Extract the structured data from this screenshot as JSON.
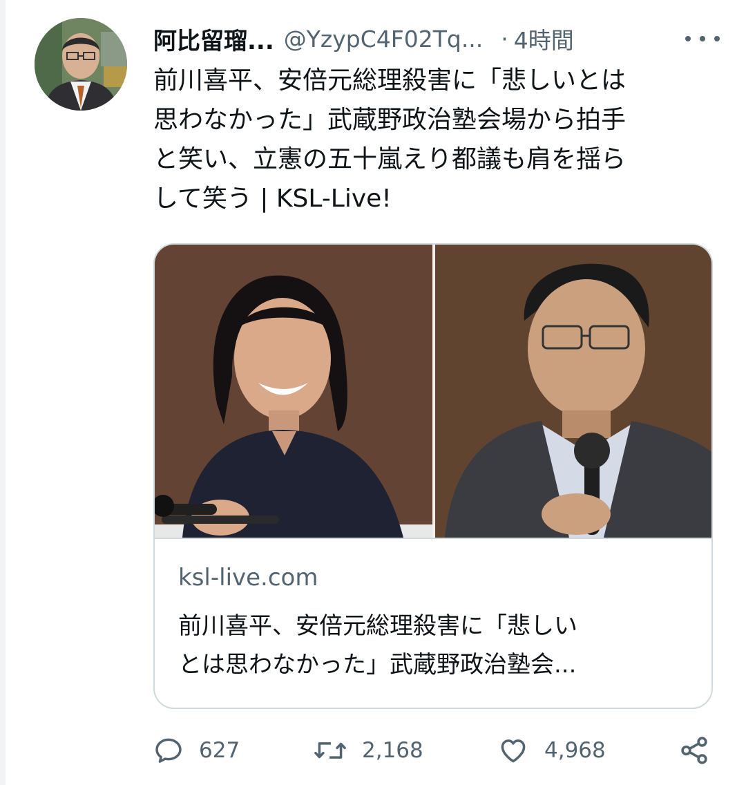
{
  "tweet": {
    "author": {
      "display_name": "阿比留瑠...",
      "handle": "@YzypC4F02Tq...",
      "separator": "·",
      "time": "4時間"
    },
    "text_lines": [
      "前川喜平、安倍元総理殺害に「悲しいとは",
      "思わなかった」武蔵野政治塾会場から拍手",
      "と笑い、立憲の五十嵐えり都議も肩を揺ら",
      "して笑う | KSL-Live!"
    ],
    "card": {
      "domain": "ksl-live.com",
      "title_lines": [
        "前川喜平、安倍元総理殺害に「悲しい",
        "とは思わなかった」武蔵野政治塾会..."
      ]
    },
    "stats": {
      "replies": "627",
      "retweets": "2,168",
      "likes": "4,968"
    }
  },
  "icons": {
    "more": "more-icon",
    "reply": "reply-icon",
    "retweet": "retweet-icon",
    "like": "heart-icon",
    "share": "share-icon"
  },
  "colors": {
    "text": "#0f1419",
    "secondary": "#536471",
    "border": "#cfd9de"
  }
}
